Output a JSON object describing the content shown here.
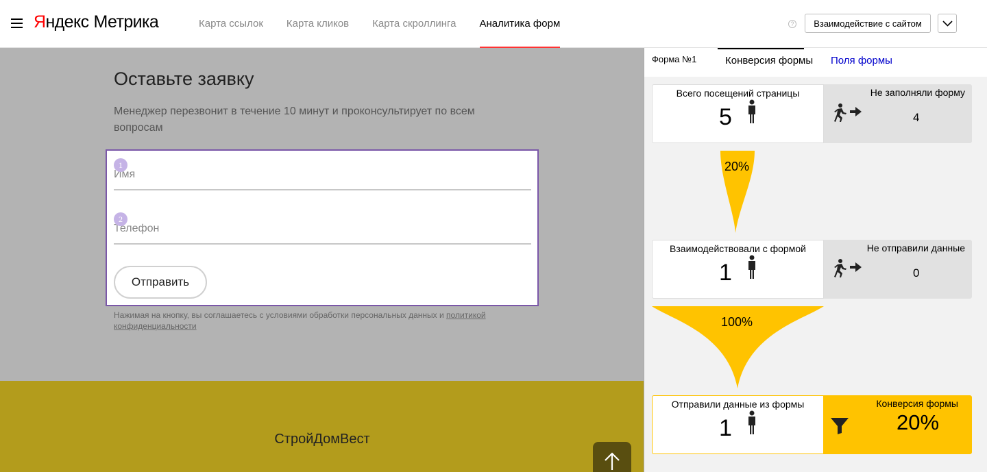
{
  "header": {
    "logo_brand_first": "Я",
    "logo_brand_rest": "ндекс",
    "logo_product": "Метрика",
    "nav": [
      {
        "label": "Карта ссылок",
        "active": false
      },
      {
        "label": "Карта кликов",
        "active": false
      },
      {
        "label": "Карта скроллинга",
        "active": false
      },
      {
        "label": "Аналитика форм",
        "active": true
      }
    ],
    "help_glyph": "?",
    "interact_button": "Взаимодействие с сайтом"
  },
  "page": {
    "title": "Оставьте заявку",
    "description": "Менеджер перезвонит в течение 10 минут и проконсультирует по всем вопросам",
    "fields": [
      {
        "number": "1",
        "label": "Имя"
      },
      {
        "number": "2",
        "label": "Телефон"
      }
    ],
    "submit_label": "Отправить",
    "consent_text": "Нажимая на кнопку, вы соглашаетесь с условиями обработки персональных данных и ",
    "consent_link": "политикой конфиденциальности",
    "footer_brand": "СтройДомВест"
  },
  "panel": {
    "form_number": "Форма №1",
    "tabs": {
      "conversion": "Конверсия формы",
      "fields": "Поля формы"
    },
    "steps": [
      {
        "title": "Всего посещений страницы",
        "value": "5",
        "side_title": "Не заполняли форму",
        "side_value": "4"
      },
      {
        "title": "Взаимодействовали с формой",
        "value": "1",
        "side_title": "Не отправили данные",
        "side_value": "0"
      },
      {
        "title": "Отправили данные из формы",
        "value": "1",
        "side_title": "Конверсия формы",
        "side_value": "20%"
      }
    ],
    "funnel_rates": [
      "20%",
      "100%"
    ]
  },
  "colors": {
    "accent_yellow": "#ffc300",
    "active_tab_underline": "#ff3333",
    "form_border": "#7a57a8",
    "link_blue": "#0000cc",
    "footer_olive": "#b39c1c"
  }
}
